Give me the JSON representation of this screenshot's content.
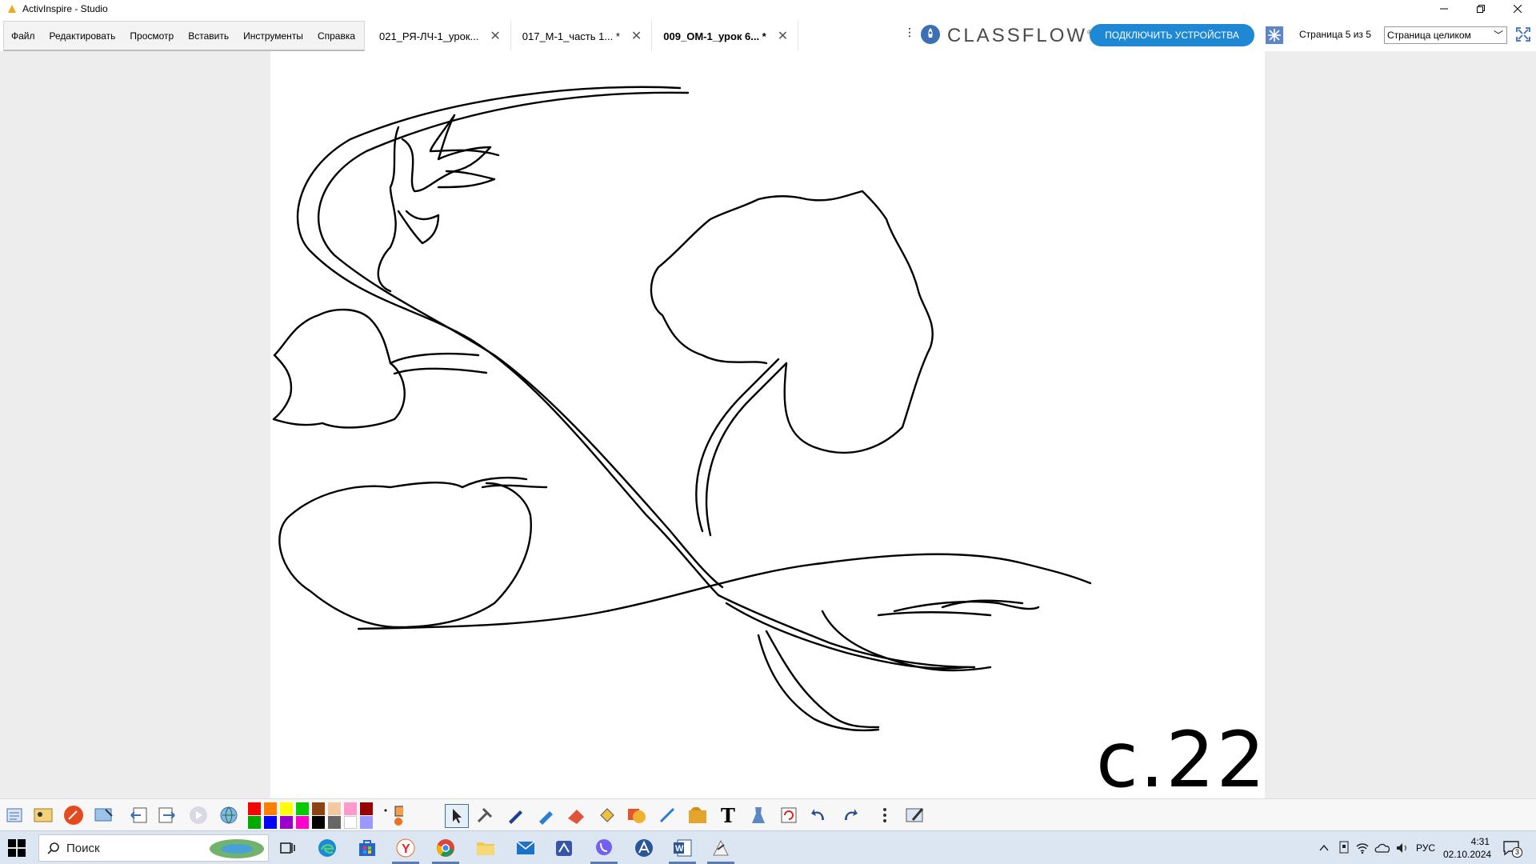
{
  "window": {
    "title": "ActivInspire - Studio"
  },
  "menu": {
    "items": [
      "Файл",
      "Редактировать",
      "Просмотр",
      "Вставить",
      "Инструменты",
      "Справка"
    ]
  },
  "tabs": [
    {
      "label": "021_РЯ-ЛЧ-1_урок...",
      "active": false
    },
    {
      "label": "017_М-1_часть 1... *",
      "active": false
    },
    {
      "label": "009_ОМ-1_урок 6... *",
      "active": true
    }
  ],
  "classflow": {
    "logo_text": "CLASSFLOW",
    "logo_mark": "®",
    "connect_button": "ПОДКЛЮЧИТЬ УСТРОЙСТВА"
  },
  "page_nav": {
    "page_info": "Страница 5 из 5",
    "zoom_value": "Страница целиком"
  },
  "canvas": {
    "page_label": "с.22"
  },
  "toolbox": {
    "colors": [
      "#ff0000",
      "#ff8000",
      "#ffff00",
      "#00cc00",
      "#8b4513",
      "#f5c9a0",
      "#ff99cc",
      "#990000",
      "#00aa00",
      "#0000ff",
      "#9900cc",
      "#ff00cc",
      "#000000",
      "#666666",
      "#ffffff",
      "#9999ff"
    ]
  },
  "taskbar": {
    "search_placeholder": "Поиск",
    "language": "РУС",
    "time": "4:31",
    "date": "02.10.2024",
    "notifications": "3"
  }
}
